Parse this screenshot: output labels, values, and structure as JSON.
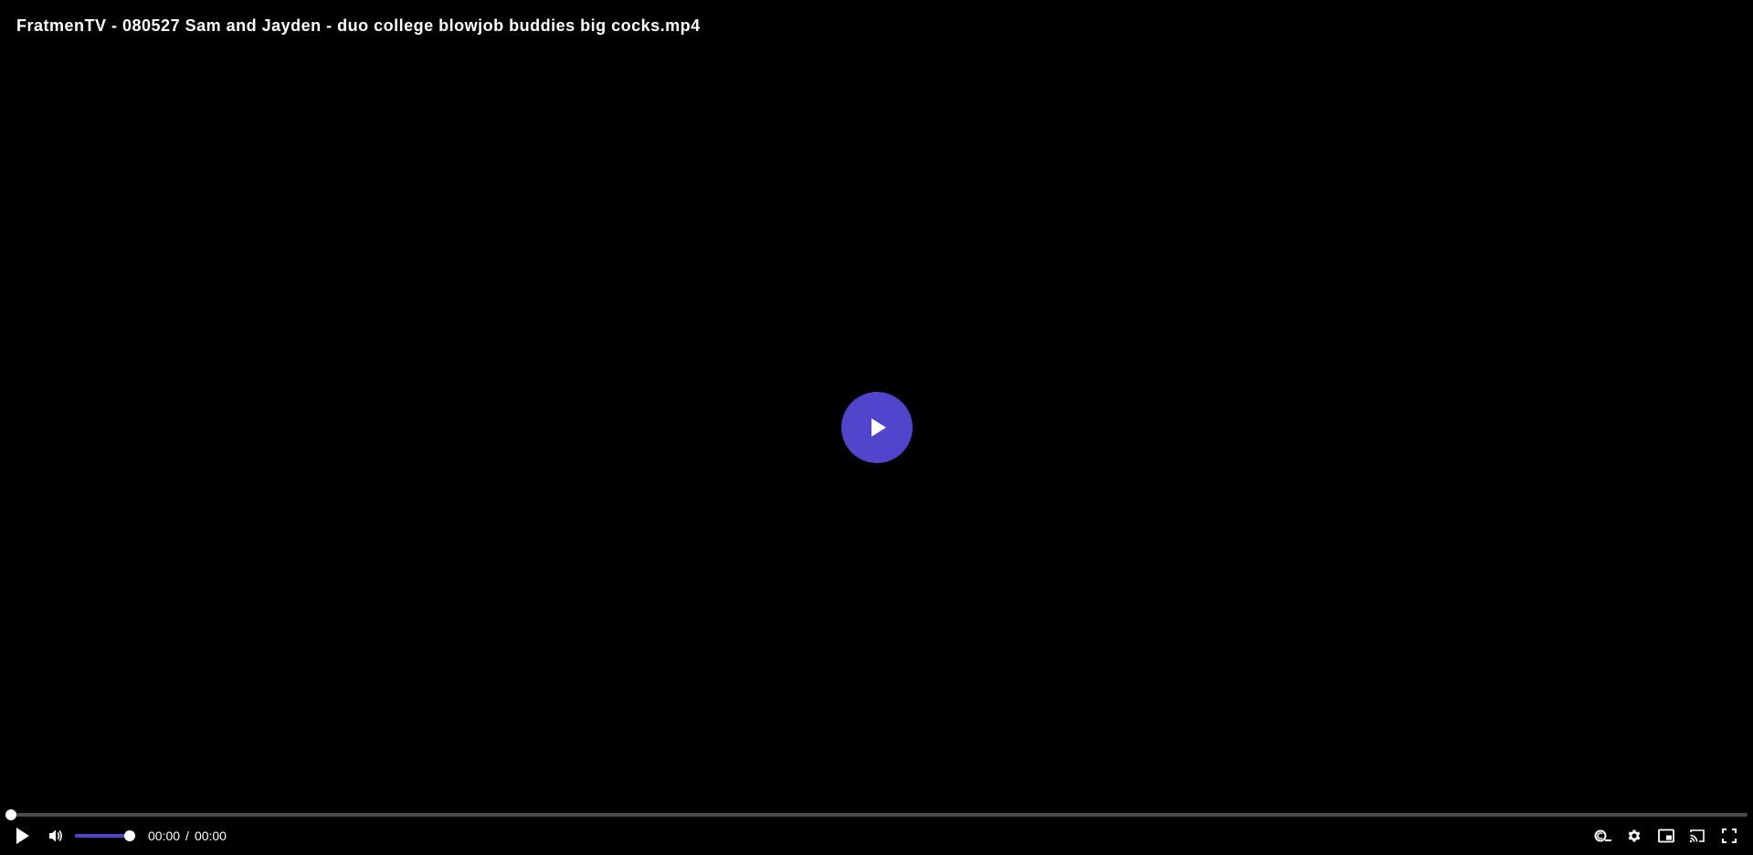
{
  "video": {
    "title": "FratmenTV - 080527 Sam and Jayden - duo college blowjob buddies big cocks.mp4"
  },
  "playback": {
    "current_time": "00:00",
    "separator": "/",
    "duration": "00:00",
    "progress_fraction": 0.0,
    "volume_fraction": 1.0
  },
  "icons": {
    "big_play": "play-icon",
    "play": "play-icon",
    "volume": "volume-icon",
    "captions": "captions-icon",
    "settings": "gear-icon",
    "pip": "picture-in-picture-icon",
    "cast": "cast-icon",
    "fullscreen": "fullscreen-icon"
  },
  "colors": {
    "accent": "#5145cd",
    "background": "#000000",
    "track": "#4a4a4a",
    "text": "#ffffff"
  }
}
